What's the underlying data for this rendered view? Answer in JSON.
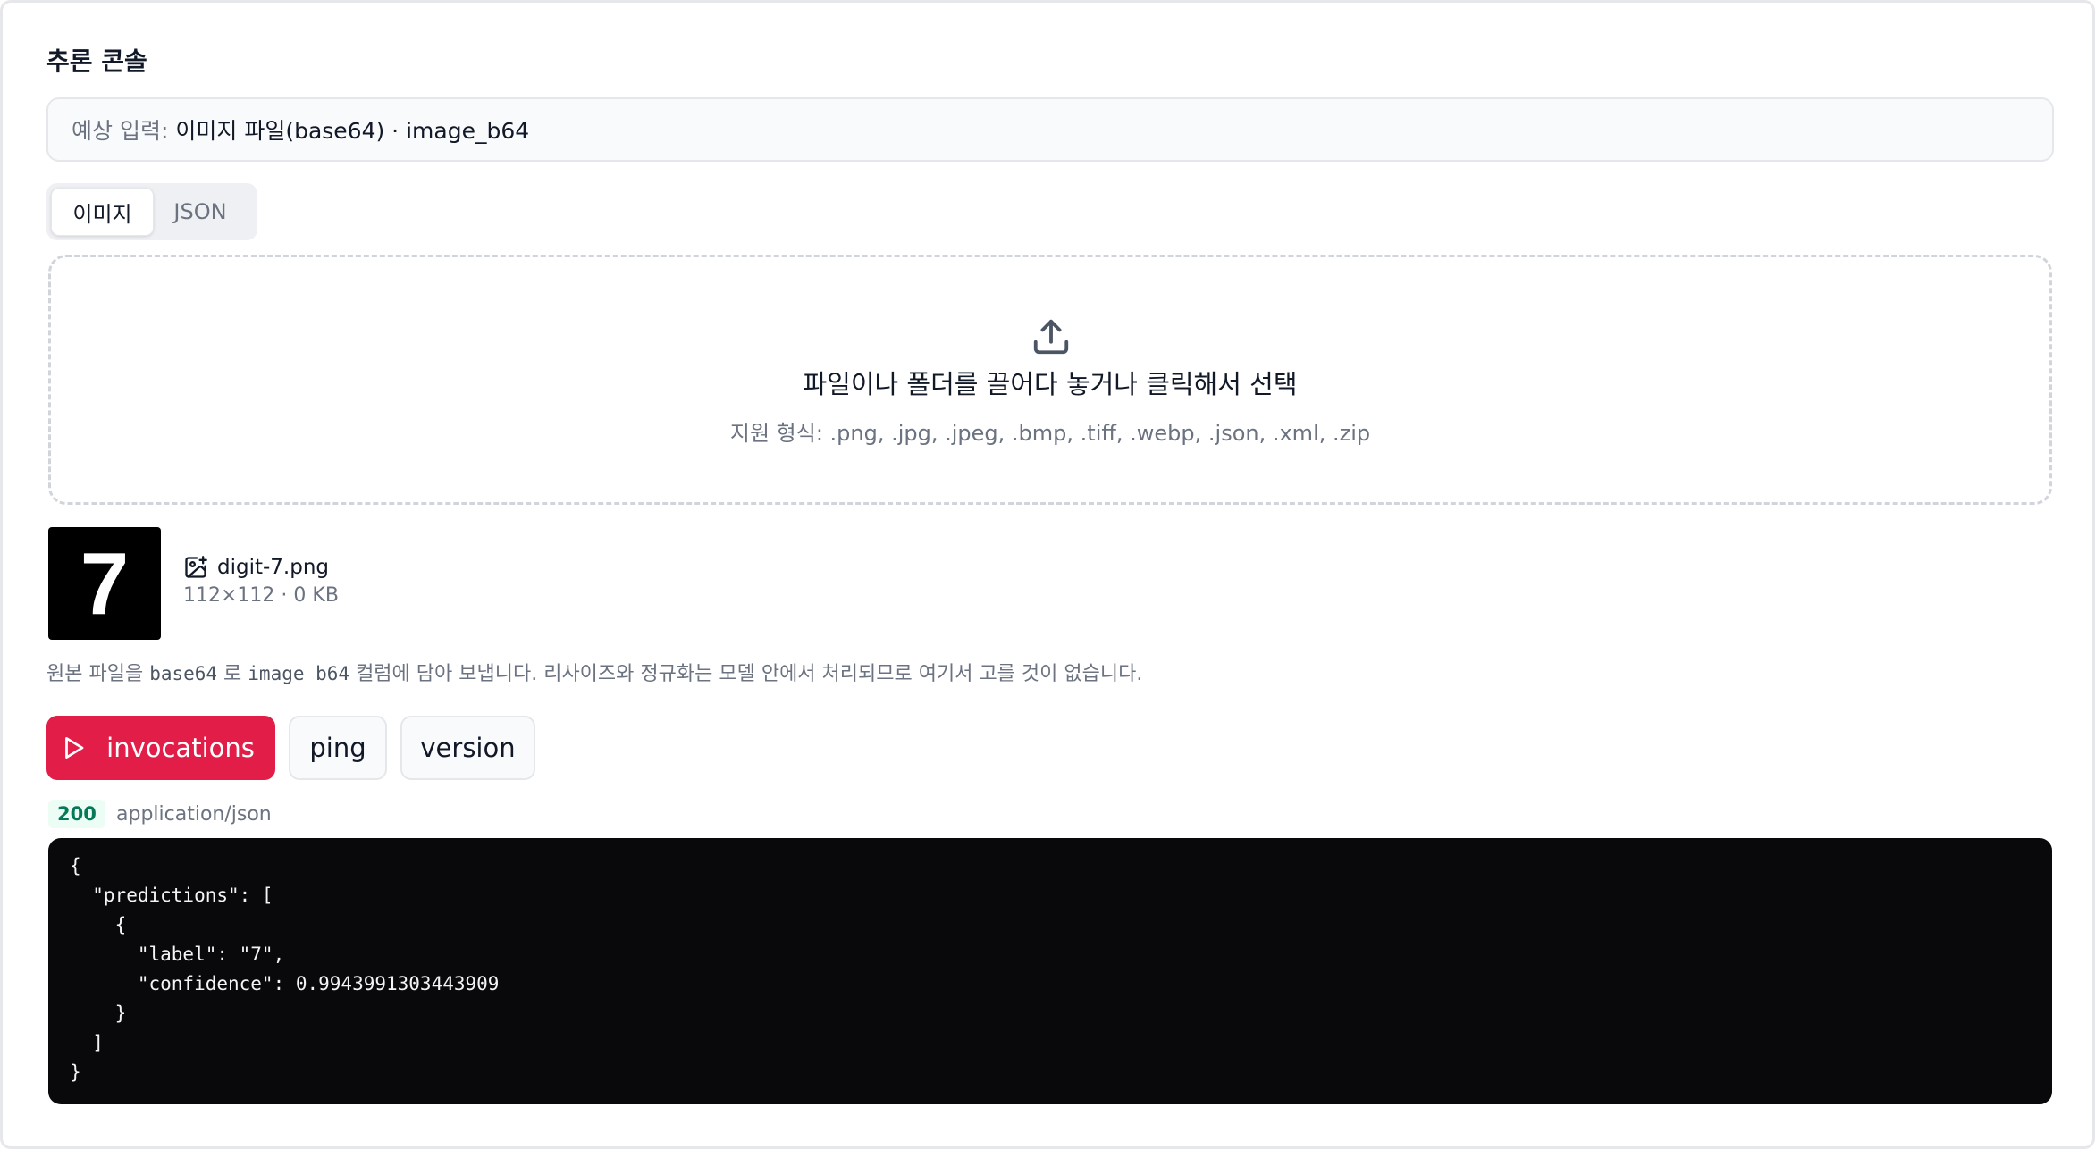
{
  "console": {
    "title": "추론 콘솔",
    "expected_input_label": "예상 입력:",
    "expected_input_value": "이미지 파일(base64) · image_b64"
  },
  "tabs": [
    {
      "label": "이미지",
      "active": true
    },
    {
      "label": "JSON",
      "active": false
    }
  ],
  "dropzone": {
    "icon": "upload-icon",
    "main_text": "파일이나 폴더를 끌어다 놓거나 클릭해서 선택",
    "supported_formats": "지원 형식: .png, .jpg, .jpeg, .bmp, .tiff, .webp, .json, .xml, .zip"
  },
  "file": {
    "thumbnail_digit": "7",
    "icon": "image-file-icon",
    "name": "digit-7.png",
    "meta": "112×112 · 0 KB"
  },
  "note": {
    "prefix": "원본 파일을 ",
    "code1": "base64",
    "mid1": " 로 ",
    "code2": "image_b64",
    "suffix": " 컬럼에 담아 보냅니다. 리사이즈와 정규화는 모델 안에서 처리되므로 여기서 고를 것이 없습니다."
  },
  "actions": {
    "invoke_label": "invocations",
    "invoke_icon": "play-icon",
    "ping_label": "ping",
    "version_label": "version"
  },
  "response": {
    "status": "200",
    "content_type": "application/json",
    "body": "{\n  \"predictions\": [\n    {\n      \"label\": \"7\",\n      \"confidence\": 0.9943991303443909\n    }\n  ]\n}"
  },
  "colors": {
    "accent": "#e11d48",
    "status_ok": "#047857",
    "code_bg": "#09090b"
  }
}
